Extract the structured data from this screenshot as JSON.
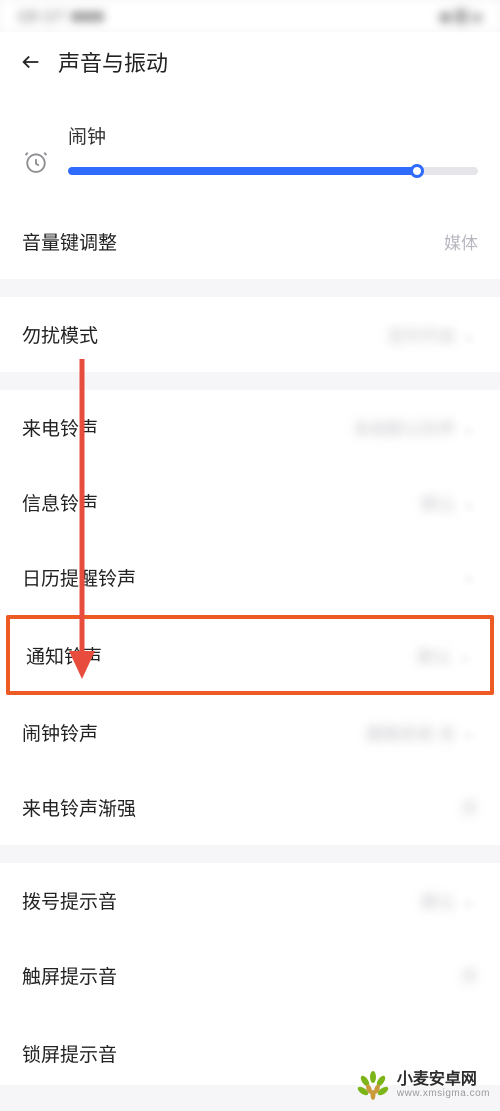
{
  "header": {
    "title": "声音与振动"
  },
  "alarm": {
    "label": "闹钟",
    "value_percent": 85
  },
  "volume_key": {
    "label": "音量键调整",
    "value": "媒体"
  },
  "rows": {
    "dnd": {
      "label": "勿扰模式",
      "value": "定时开启"
    },
    "incoming": {
      "label": "来电铃声",
      "value": "系统默认铃声"
    },
    "message": {
      "label": "信息铃声",
      "value": "默认"
    },
    "calendar": {
      "label": "日历提醒铃声",
      "value": ""
    },
    "notify": {
      "label": "通知铃声",
      "value": "默认"
    },
    "alarmtone": {
      "label": "闹钟铃声",
      "value": "跟随系统 关"
    },
    "crescendo": {
      "label": "来电铃声渐强",
      "value": "开"
    },
    "dialtone": {
      "label": "拨号提示音",
      "value": "默认"
    },
    "touchtone": {
      "label": "触屏提示音",
      "value": "开"
    },
    "locktone": {
      "label": "锁屏提示音",
      "value": ""
    }
  },
  "watermark": {
    "name": "小麦安卓网",
    "url": "www.xmsigma.com"
  }
}
